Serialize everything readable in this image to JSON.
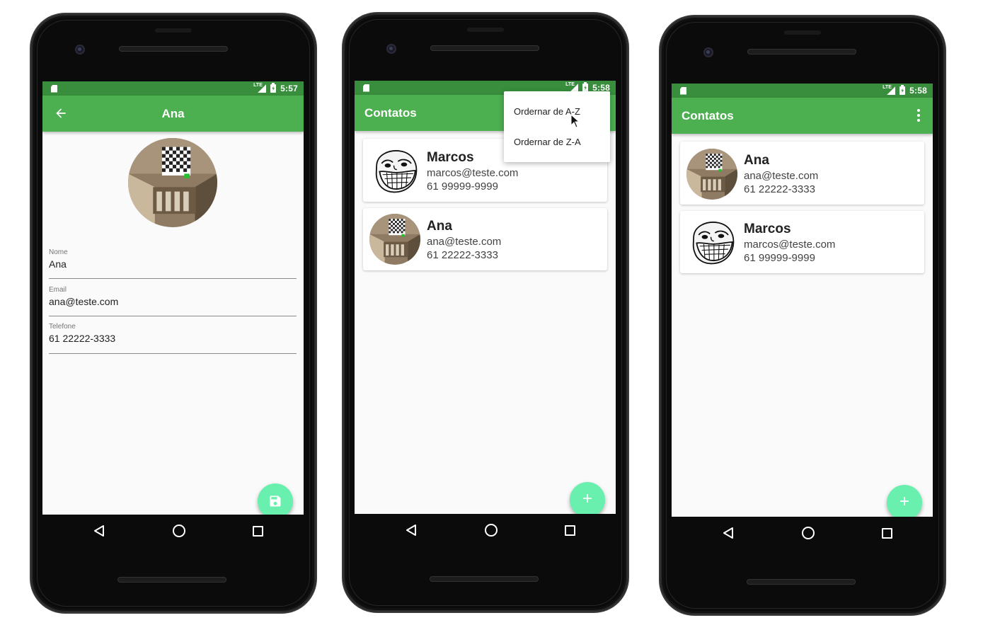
{
  "screen1": {
    "status_time": "5:57",
    "title": "Ana",
    "fields": [
      {
        "label": "Nome",
        "value": "Ana"
      },
      {
        "label": "Email",
        "value": "ana@teste.com"
      },
      {
        "label": "Telefone",
        "value": "61 22222-3333"
      }
    ],
    "fab_icon": "save-icon"
  },
  "screen2": {
    "status_time": "5:58",
    "title": "Contatos",
    "menu": {
      "items": [
        {
          "label": "Ordernar de A-Z"
        },
        {
          "label": "Ordernar de Z-A"
        }
      ]
    },
    "contacts": [
      {
        "name": "Marcos",
        "email": "marcos@teste.com",
        "phone": "61 99999-9999",
        "avatar": "trollface"
      },
      {
        "name": "Ana",
        "email": "ana@teste.com",
        "phone": "61 22222-3333",
        "avatar": "photo"
      }
    ],
    "fab_label": "+"
  },
  "screen3": {
    "status_time": "5:58",
    "title": "Contatos",
    "contacts": [
      {
        "name": "Ana",
        "email": "ana@teste.com",
        "phone": "61 22222-3333",
        "avatar": "photo"
      },
      {
        "name": "Marcos",
        "email": "marcos@teste.com",
        "phone": "61 99999-9999",
        "avatar": "trollface"
      }
    ],
    "fab_label": "+"
  },
  "colors": {
    "status_bar": "#388e3c",
    "app_bar": "#4caf50",
    "fab": "#69f0ae",
    "background": "#fafafa"
  }
}
